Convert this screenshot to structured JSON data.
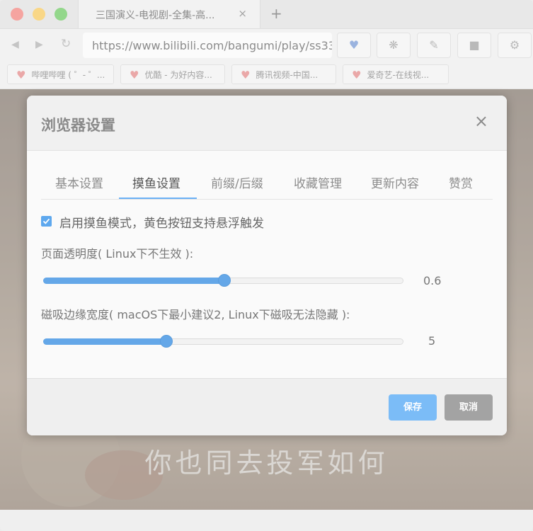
{
  "browser": {
    "tab": {
      "title": "三国演义-电视剧-全集-高...",
      "close_glyph": "×"
    },
    "new_tab_glyph": "+",
    "url": "https://www.bilibili.com/bangumi/play/ss33",
    "bookmarks": [
      {
        "label": "哔哩哔哩 ( ゜- ゜..."
      },
      {
        "label": "优酷 - 为好内容..."
      },
      {
        "label": "腾讯视频-中国..."
      },
      {
        "label": "爱奇艺-在线视..."
      }
    ],
    "video_subtitle": "你也同去投军如何"
  },
  "dialog": {
    "title": "浏览器设置",
    "close_glyph": "×",
    "tabs": [
      {
        "label": "基本设置",
        "active": false
      },
      {
        "label": "摸鱼设置",
        "active": true
      },
      {
        "label": "前缀/后缀",
        "active": false
      },
      {
        "label": "收藏管理",
        "active": false
      },
      {
        "label": "更新内容",
        "active": false
      },
      {
        "label": "赞赏",
        "active": false
      }
    ],
    "fish_mode": {
      "checked": true,
      "label": "启用摸鱼模式，黄色按钮支持悬浮触发"
    },
    "opacity": {
      "label": "页面透明度( Linux下不生效 ):",
      "value": "0.6",
      "fraction": 0.5
    },
    "snap_width": {
      "label": "磁吸边缘宽度( macOS下最小建议2, Linux下磁吸无法隐藏 ):",
      "value": "5",
      "fraction": 0.34
    },
    "save_label": "保存",
    "cancel_label": "取消"
  },
  "colors": {
    "accent": "#64a7e8",
    "save_button": "#7bbcf7",
    "cancel_button": "#a3a3a3"
  }
}
